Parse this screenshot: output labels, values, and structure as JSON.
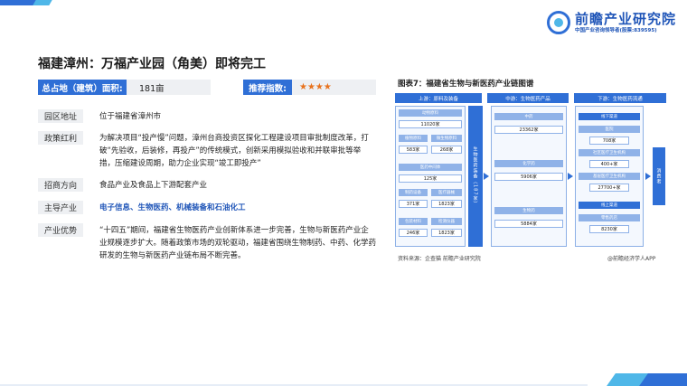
{
  "logo": {
    "title": "前瞻产业研究院",
    "subtitle": "中国产业咨询领导者(股票:839595)"
  },
  "page": {
    "title": "福建漳州：万福产业园（角美）即将完工"
  },
  "info": {
    "area_label": "总占地（建筑）面积:",
    "area_value": "181亩",
    "rating_label": "推荐指数:",
    "rating_stars": "★★★★",
    "rating_value": 4
  },
  "rows": [
    {
      "label": "园区地址",
      "value": "位于福建省漳州市"
    },
    {
      "label": "政策红利",
      "value": "为解决项目“投产慢”问题，漳州台商投资区探化工程建设项目审批制度改革，打破“先验收，后装修，再投产”的传统模式，创新采用模拟验收和并联审批等举措，压缩建设周期，助力企业实现“竣工即投产”"
    },
    {
      "label": "招商方向",
      "value": "食品产业及食品上下游配套产业"
    },
    {
      "label": "主导产业",
      "value": "电子信息、生物医药、机械装备和石油化工"
    },
    {
      "label": "产业优势",
      "value": "“十四五”期间，福建省生物医药产业创新体系进一步完善，生物与新医药产业企业规模逐步扩大。随着政策市场的双轮驱动，福建省围绕生物制药、中药、化学药研发的生物与新医药产业链布局不断完善。"
    }
  ],
  "figure": {
    "title": "图表7：福建省生物与新医药产业链图谱",
    "upstream_header": "上游：原料及装备",
    "midstream_header": "中游：生物医药产品",
    "downstream_header": "下游：生物医药流通",
    "center_label": "生物医药装备（187家）",
    "end_label": "消费者",
    "upstream": {
      "bar1": "动物原料",
      "val1": "11020家",
      "bar2": "植物原料",
      "bar3": "微生物原料",
      "val2": "583家",
      "val3": "268家",
      "bar4": "医药中间体",
      "val4": "125家",
      "bar5": "制药设备",
      "bar6": "医疗器械",
      "val5": "371家",
      "val6": "1823家",
      "bar7": "包装材料",
      "bar8": "检测仪器",
      "val7": "246家",
      "val8": "1823家"
    },
    "midstream": {
      "bar1": "中药",
      "val1": "23362家",
      "bar2": "化学药",
      "val2": "5906家",
      "bar3": "生物药",
      "val3": "5884家"
    },
    "downstream": {
      "bar1": "线下渠道",
      "bar2": "医院",
      "val2": "708家",
      "bar3": "社区医疗卫生机构",
      "val3": "400+家",
      "bar4": "基层医疗卫生机构",
      "val4": "27700+家",
      "bar5": "线上渠道",
      "bar6": "零售药店",
      "val6": "8230家"
    },
    "source": "资料来源：企查猫 前瞻产业研究院",
    "credit": "@前瞻经济学人APP"
  },
  "colors": {
    "accent": "#2f6fd6",
    "light_accent": "#4fb7e8",
    "star": "#e8721c",
    "label_bg": "#eef0f3"
  }
}
